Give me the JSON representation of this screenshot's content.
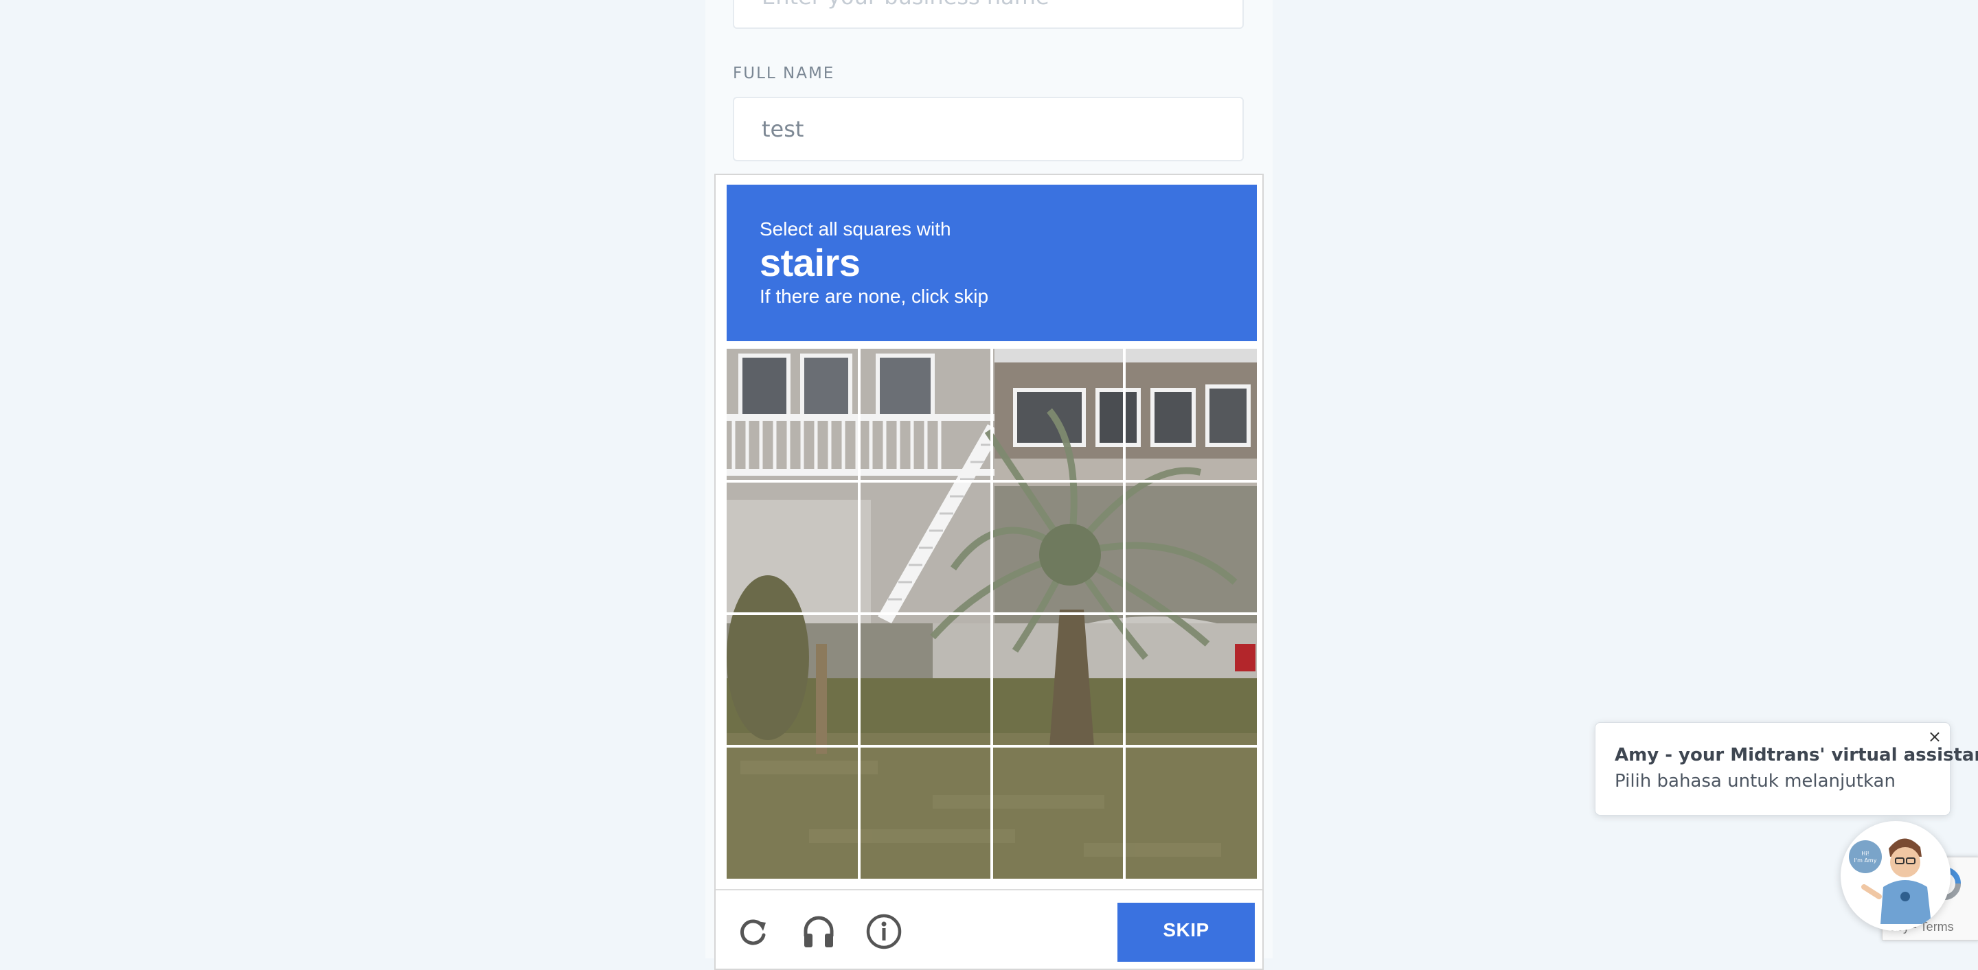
{
  "form": {
    "business_placeholder": "Enter your business name",
    "full_name_label": "FULL NAME",
    "full_name_value": "test"
  },
  "captcha": {
    "instruction": "Select all squares with",
    "target": "stairs",
    "hint": "If there are none, click skip",
    "grid_rows": 4,
    "grid_cols": 4,
    "tools": [
      "reload-icon",
      "headphones-icon",
      "info-icon"
    ],
    "skip_label": "SKIP",
    "header_color": "#3a72e0"
  },
  "chat": {
    "title": "Amy - your Midtrans' virtual assistant",
    "subtitle": "Pilih bahasa untuk melanjutkan",
    "close_glyph": "×",
    "avatar_text": "Hi! I'm Amy"
  },
  "recaptcha": {
    "terms": "acy - Terms"
  }
}
